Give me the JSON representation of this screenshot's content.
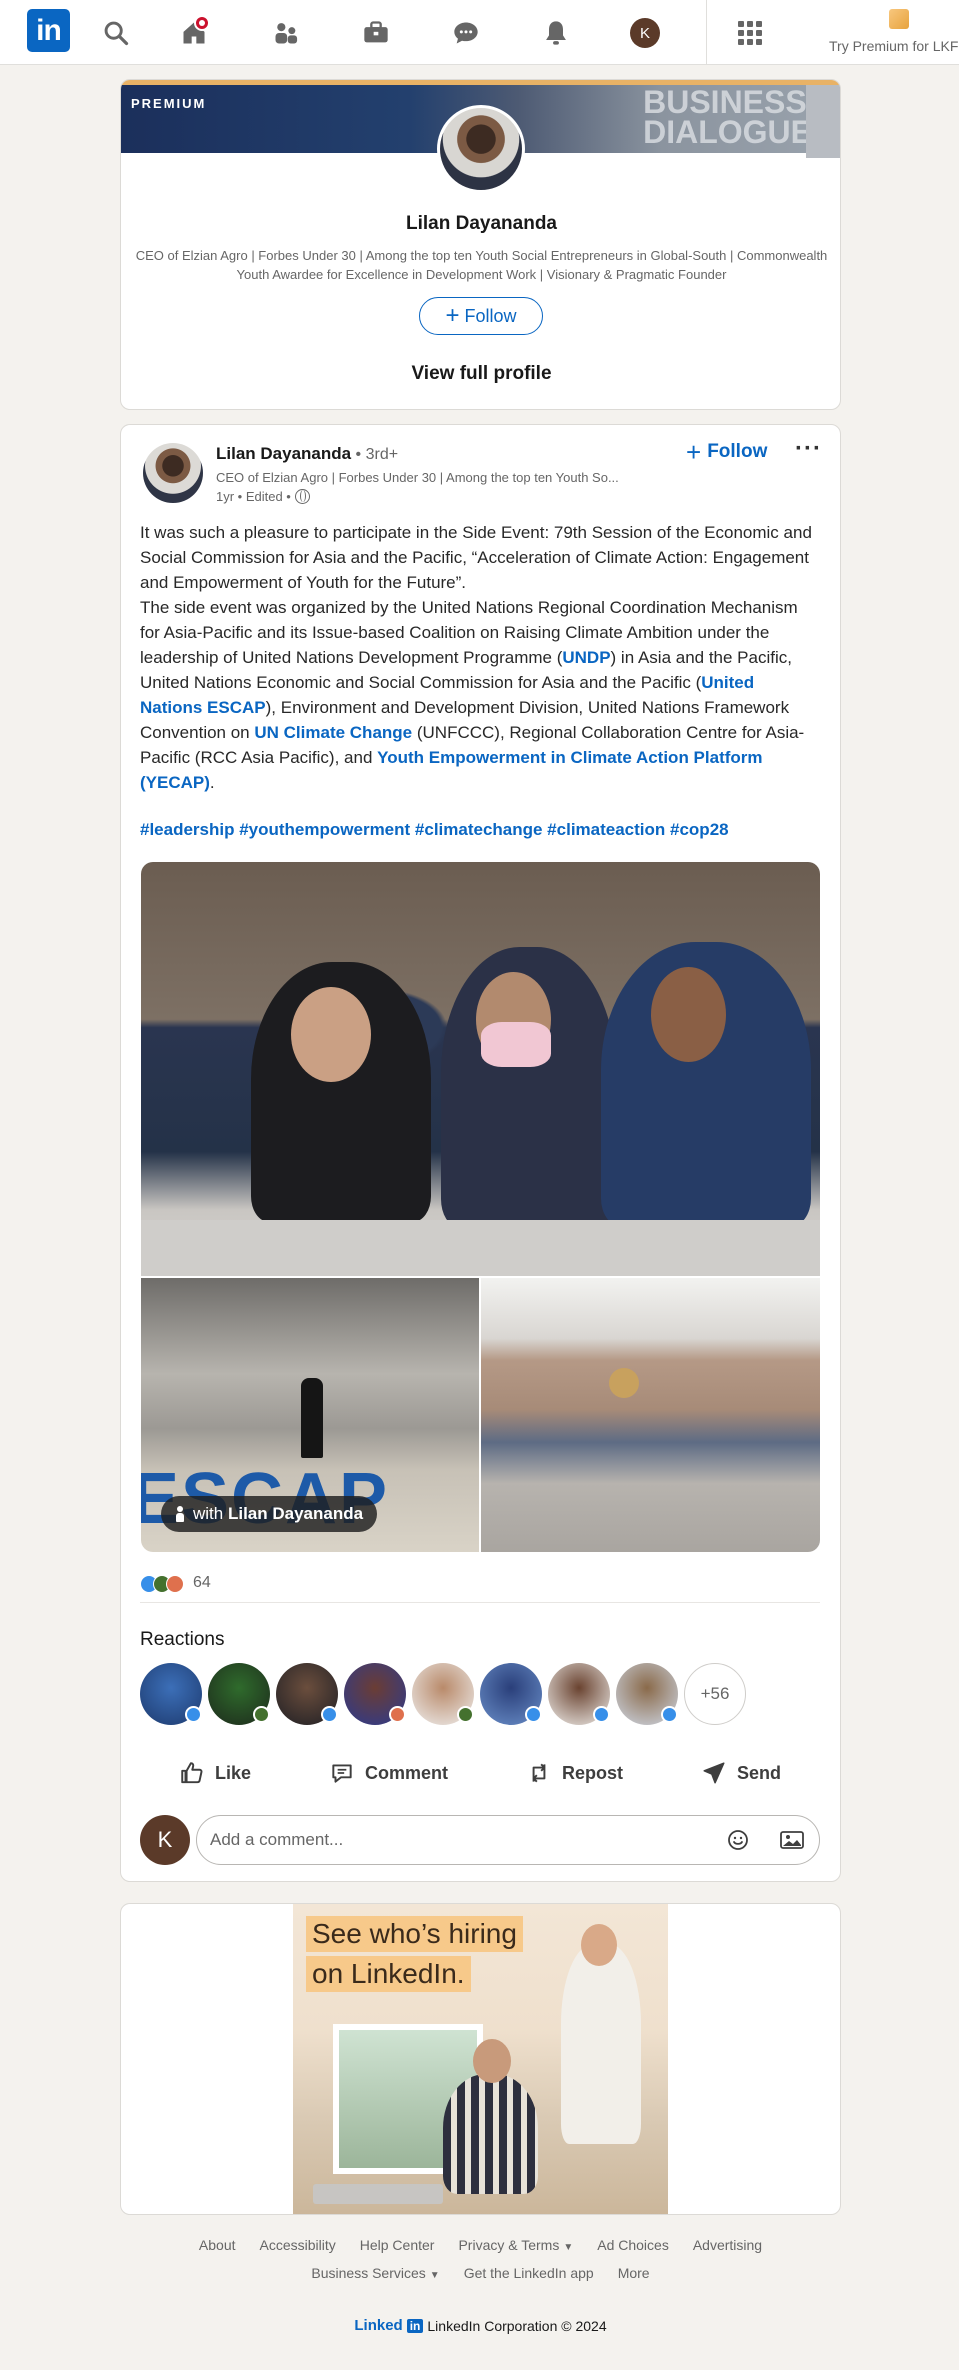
{
  "nav": {
    "logo": "in",
    "avatar_initial": "K",
    "premium_label": "Try Premium for LKF",
    "home_badge": true
  },
  "profile_card": {
    "banner_label": "PREMIUM",
    "banner_text_1": "BUSINESS",
    "banner_text_2": "DIALOGUE",
    "name": "Lilan Dayananda",
    "headline": "CEO of Elzian Agro | Forbes Under 30 | Among the top ten Youth Social Entrepreneurs in Global-South | Commonwealth Youth Awardee for Excellence in Development Work | Visionary & Pragmatic Founder",
    "follow_label": "Follow",
    "view_profile_label": "View full profile"
  },
  "post": {
    "author_name": "Lilan Dayananda",
    "degree": " • 3rd+",
    "author_headline": "CEO of Elzian Agro | Forbes Under 30 | Among the top ten Youth So...",
    "meta": "1yr • Edited •",
    "follow_label": "Follow",
    "more_label": "···",
    "body": {
      "p1": "It was such a pleasure to participate in the Side Event: 79th Session of the Economic and Social Commission for Asia and the Pacific, “Acceleration of Climate Action: Engagement and Empowerment of Youth for the Future”.",
      "p2a": "The side event was organized by the United Nations Regional Coordination Mechanism for Asia-Pacific and its Issue-based Coalition on Raising Climate Ambition under the leadership of United Nations Development Programme (",
      "link_undp": "UNDP",
      "p2b": ") in Asia and the Pacific, United Nations Economic and Social Commission for Asia and the Pacific (",
      "link_escap": "United Nations ESCAP",
      "p2c": "), Environment and Development Division, United Nations Framework Convention on ",
      "link_unfccc": "UN Climate Change",
      "p2d": " (UNFCCC), Regional Collaboration Centre for Asia-Pacific (RCC Asia Pacific), and ",
      "link_yecap": "Youth Empowerment in Climate Action Platform (YECAP)",
      "p2e": "."
    },
    "hashtags": "#leadership #youthempowerment #climatechange #climateaction #cop28",
    "image_tag_prefix": "with",
    "image_tag_name": "Lilan Dayananda",
    "image_text_escap": "ESCAP",
    "reaction_count": "64",
    "reactions_title": "Reactions",
    "more_reactors": "+56",
    "actions": {
      "like": "Like",
      "comment": "Comment",
      "repost": "Repost",
      "send": "Send"
    },
    "comment_avatar_initial": "K",
    "comment_placeholder": "Add a comment..."
  },
  "ad": {
    "line1": "See who’s hiring",
    "line2": "on LinkedIn."
  },
  "footer": {
    "links_row1": [
      "About",
      "Accessibility",
      "Help Center",
      "Privacy & Terms",
      "Ad Choices",
      "Advertising"
    ],
    "links_row2": [
      "Business Services",
      "Get the LinkedIn app",
      "More"
    ],
    "brand_linked": "Linked",
    "brand_in": "in",
    "copyright": "LinkedIn Corporation © 2024"
  },
  "colors": {
    "accent": "#0a66c2",
    "background": "#f4f2ee",
    "premium_gold": "#e8b266"
  },
  "icons": [
    "linkedin-logo",
    "search-icon",
    "home-icon",
    "people-icon",
    "briefcase-icon",
    "messaging-icon",
    "bell-icon",
    "grid-icon",
    "premium-icon",
    "globe-icon",
    "plus-icon",
    "like-icon",
    "comment-icon",
    "repost-icon",
    "send-icon",
    "emoji-icon",
    "photo-icon"
  ]
}
